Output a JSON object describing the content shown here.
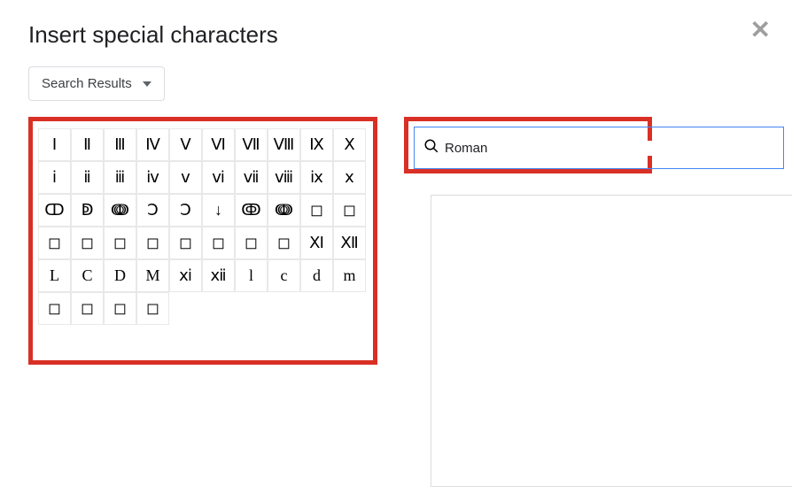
{
  "dialog": {
    "title": "Insert special characters",
    "close_label": "✕"
  },
  "categorySelector": {
    "label": "Search Results"
  },
  "search": {
    "value": "Roman"
  },
  "characters": [
    "Ⅰ",
    "Ⅱ",
    "Ⅲ",
    "Ⅳ",
    "Ⅴ",
    "Ⅵ",
    "Ⅶ",
    "Ⅷ",
    "Ⅸ",
    "Ⅹ",
    "ⅰ",
    "ⅱ",
    "ⅲ",
    "ⅳ",
    "ⅴ",
    "ⅵ",
    "ⅶ",
    "ⅷ",
    "ⅸ",
    "ⅹ",
    "ↀ",
    "ↁ",
    "ↈ",
    "Ↄ",
    "Ↄ",
    "↓",
    "ↂ",
    "ↈ",
    "◻",
    "◻",
    "◻",
    "◻",
    "◻",
    "◻",
    "◻",
    "◻",
    "◻",
    "◻",
    "Ⅺ",
    "Ⅻ",
    "L",
    "C",
    "D",
    "M",
    "ⅺ",
    "ⅻ",
    "l",
    "c",
    "d",
    "m",
    "◻",
    "◻",
    "◻",
    "◻"
  ]
}
